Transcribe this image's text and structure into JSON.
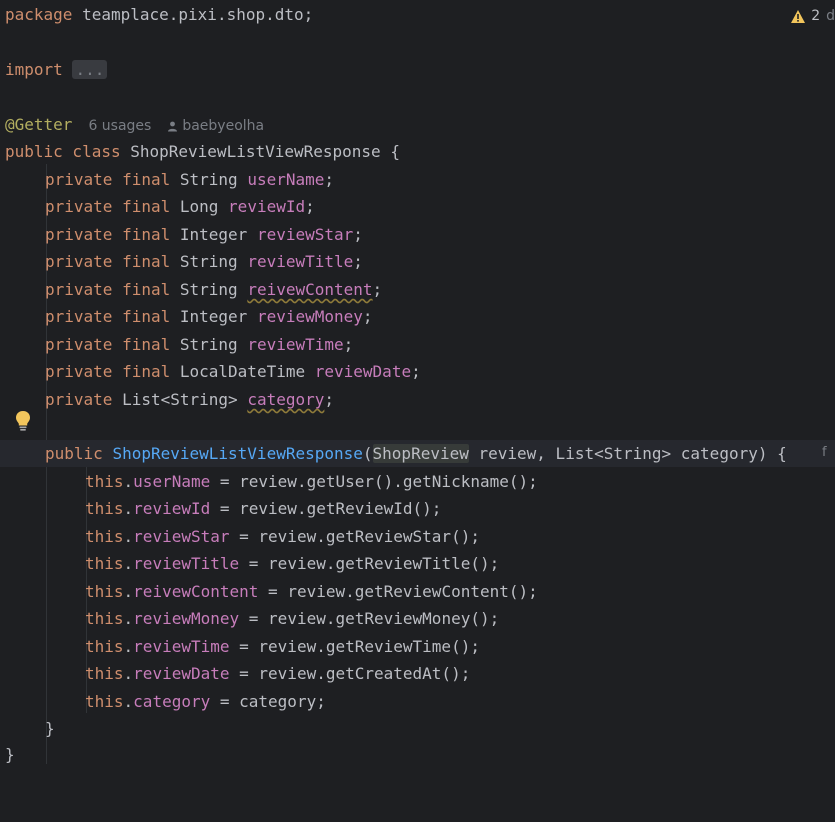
{
  "editor": {
    "warnings_count": "2",
    "package_kw": "package",
    "package_name": "teamplace.pixi.shop.dto",
    "import_kw": "import",
    "import_folded": "...",
    "annotation": "@Getter",
    "usages_hint": "6 usages",
    "author_hint": "baebyeolha",
    "class_modifiers": "public class",
    "class_name": "ShopReviewListViewResponse",
    "fields": [
      {
        "mods": "private final",
        "type": "String",
        "name": "userName"
      },
      {
        "mods": "private final",
        "type": "Long",
        "name": "reviewId"
      },
      {
        "mods": "private final",
        "type": "Integer",
        "name": "reviewStar"
      },
      {
        "mods": "private final",
        "type": "String",
        "name": "reviewTitle"
      },
      {
        "mods": "private final",
        "type": "String",
        "name": "reivewContent"
      },
      {
        "mods": "private final",
        "type": "Integer",
        "name": "reviewMoney"
      },
      {
        "mods": "private final",
        "type": "String",
        "name": "reviewTime"
      },
      {
        "mods": "private final",
        "type": "LocalDateTime",
        "name": "reviewDate"
      },
      {
        "mods": "private",
        "type": "List<String>",
        "name": "category"
      }
    ],
    "ctor": {
      "mod": "public",
      "name": "ShopReviewListViewResponse",
      "param1_type": "ShopReview",
      "param1_rest": " review, List<String> category) {"
    },
    "assignments": [
      {
        "field": "userName",
        "rhs": "review.getUser().getNickname();"
      },
      {
        "field": "reviewId",
        "rhs": "review.getReviewId();"
      },
      {
        "field": "reviewStar",
        "rhs": "review.getReviewStar();"
      },
      {
        "field": "reviewTitle",
        "rhs": "review.getReviewTitle();"
      },
      {
        "field": "reivewContent",
        "rhs": "review.getReviewContent();"
      },
      {
        "field": "reviewMoney",
        "rhs": "review.getReviewMoney();"
      },
      {
        "field": "reviewTime",
        "rhs": "review.getReviewTime();"
      },
      {
        "field": "reviewDate",
        "rhs": "review.getCreatedAt();"
      },
      {
        "field": "category",
        "rhs": "category;"
      }
    ],
    "this_kw": "this",
    "close_method": "}",
    "close_class": "}",
    "colors": {
      "background": "#1e1f22",
      "keyword": "#cf8e6d",
      "field": "#c77dbb",
      "annotation": "#b3ae60",
      "function": "#56a8f5",
      "text": "#bcbec4",
      "warning": "#f2c55c"
    },
    "icons": [
      "warning-icon",
      "lightbulb-icon",
      "person-icon"
    ]
  }
}
